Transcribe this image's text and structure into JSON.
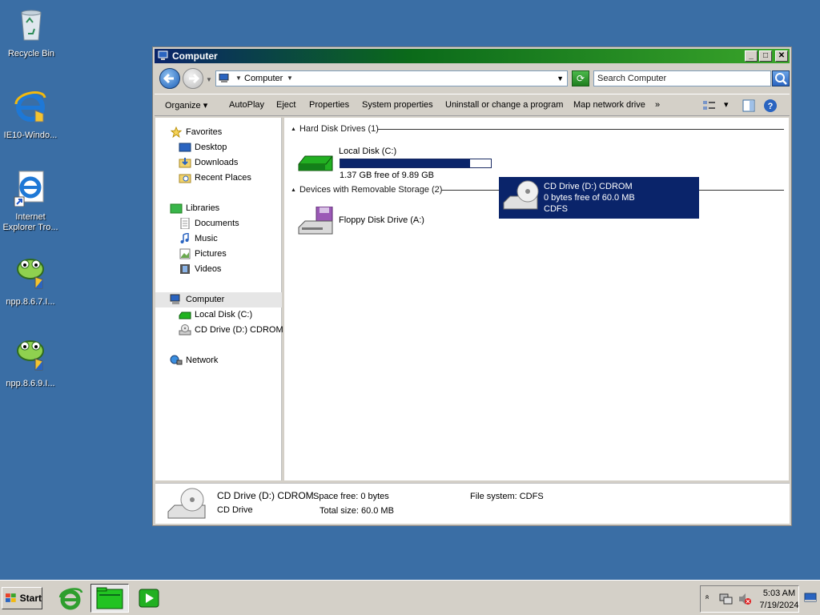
{
  "desktop": {
    "icons": [
      {
        "label": "Recycle Bin"
      },
      {
        "label": "IE10-Windo..."
      },
      {
        "label": "Internet Explorer Tro..."
      },
      {
        "label": "npp.8.6.7.I..."
      },
      {
        "label": "npp.8.6.9.I..."
      }
    ]
  },
  "window": {
    "title": "Computer",
    "controls": {
      "minimize": "_",
      "maximize": "□",
      "close": "✕"
    },
    "address": {
      "path": "Computer"
    },
    "search": {
      "placeholder": "Search Computer"
    },
    "commands": [
      "Organize",
      "AutoPlay",
      "Eject",
      "Properties",
      "System properties",
      "Uninstall or change a program",
      "Map network drive",
      "»"
    ],
    "nav": {
      "favorites": "Favorites",
      "desktop": "Desktop",
      "downloads": "Downloads",
      "recent_places": "Recent Places",
      "libraries": "Libraries",
      "documents": "Documents",
      "music": "Music",
      "pictures": "Pictures",
      "videos": "Videos",
      "computer": "Computer",
      "local_disk": "Local Disk (C:)",
      "cd_drive": "CD Drive (D:) CDROM",
      "network": "Network"
    },
    "groups": {
      "hard_disk": {
        "header": "Hard Disk Drives (1)",
        "drive": {
          "name": "Local Disk (C:)",
          "free": "1.37 GB free of 9.89 GB",
          "used_fraction": 0.861
        }
      },
      "removable": {
        "header": "Devices with Removable Storage (2)",
        "floppy": {
          "name": "Floppy Disk Drive (A:)"
        },
        "cd": {
          "name": "CD Drive (D:) CDROM",
          "free": "0 bytes free of 60.0 MB",
          "fs": "CDFS"
        }
      }
    },
    "details": {
      "name": "CD Drive (D:) CDROM",
      "type": "CD Drive",
      "space_free": "Space free: 0 bytes",
      "total_size": "Total size: 60.0 MB",
      "file_system": "File system: CDFS"
    }
  },
  "taskbar": {
    "start": "Start",
    "clock": {
      "time": "5:03 AM",
      "date": "7/19/2024"
    },
    "tray_expand": "»"
  },
  "colors": {
    "desktop": "#3a6ea5",
    "selection": "#0a246a",
    "title_gradient_start": "#0a246a",
    "title_gradient_end": "#3aa52a"
  }
}
